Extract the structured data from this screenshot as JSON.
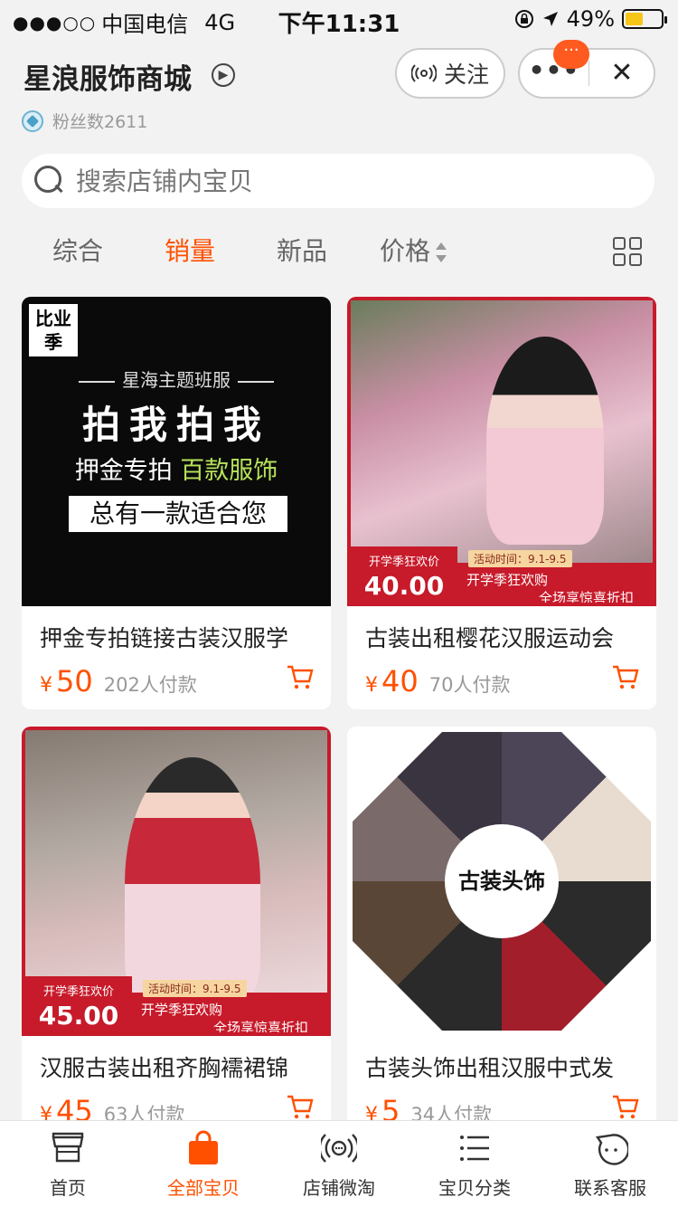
{
  "status_bar": {
    "signal_dots": "●●●○○",
    "carrier": "中国电信",
    "network": "4G",
    "time": "下午11:31",
    "battery": "49%",
    "battery_level": 0.49
  },
  "shop": {
    "name": "星浪服饰商城",
    "fans": "粉丝数2611",
    "follow_label": "关注",
    "more_badge": "···"
  },
  "search": {
    "placeholder": "搜索店铺内宝贝"
  },
  "sort_tabs": [
    {
      "label": "综合"
    },
    {
      "label": "销量",
      "active": true
    },
    {
      "label": "新品"
    },
    {
      "label": "价格"
    }
  ],
  "products": [
    {
      "title": "押金专拍链接古装汉服学",
      "yen": "¥",
      "price": "50",
      "sold": "202人付款",
      "image_text": {
        "logo": "比业季",
        "slogan": "星海主题班服",
        "big": "拍我拍我",
        "mid_a": "押金专拍",
        "mid_b": "百款服饰",
        "box": "总有一款适合您"
      }
    },
    {
      "title": "古装出租樱花汉服运动会",
      "yen": "¥",
      "price": "40",
      "sold": "70人付款",
      "promo": {
        "label": "开学季狂欢价",
        "price": "40.00",
        "time": "活动时间：9.1-9.5",
        "line_a": "开学季狂欢购",
        "line_b": "全场享惊喜折扣"
      }
    },
    {
      "title": "汉服古装出租齐胸襦裙锦",
      "yen": "¥",
      "price": "45",
      "sold": "63人付款",
      "promo": {
        "label": "开学季狂欢价",
        "price": "45.00",
        "time": "活动时间：9.1-9.5",
        "line_a": "开学季狂欢购",
        "line_b": "全场享惊喜折扣"
      }
    },
    {
      "title": "古装头饰出租汉服中式发",
      "yen": "¥",
      "price": "5",
      "sold": "34人付款",
      "image_text": {
        "circle": "古装头饰"
      }
    }
  ],
  "tab_bar": [
    {
      "label": "首页",
      "icon": "store-icon"
    },
    {
      "label": "全部宝贝",
      "icon": "shopping-bag-icon",
      "active": true
    },
    {
      "label": "店铺微淘",
      "icon": "broadcast-icon"
    },
    {
      "label": "宝贝分类",
      "icon": "list-icon"
    },
    {
      "label": "联系客服",
      "icon": "chat-face-icon"
    }
  ],
  "colors": {
    "accent": "#ff5000",
    "promo_red": "#c71a2a",
    "background": "#f2f2f2"
  }
}
